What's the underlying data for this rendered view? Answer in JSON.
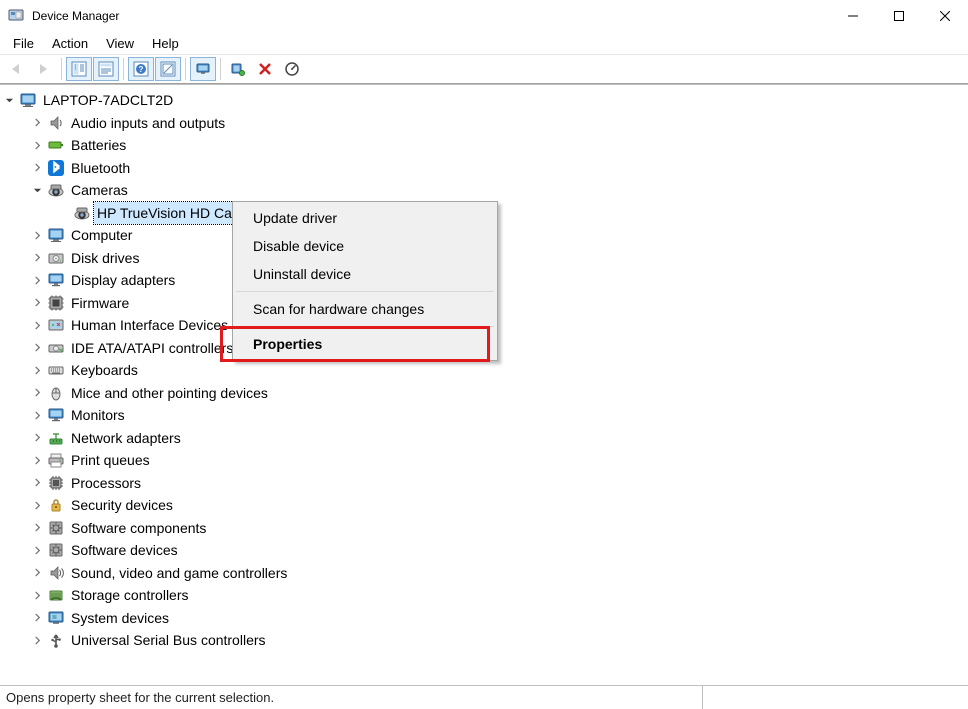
{
  "window": {
    "title": "Device Manager"
  },
  "menubar": [
    "File",
    "Action",
    "View",
    "Help"
  ],
  "tree": {
    "root": "LAPTOP-7ADCLT2D",
    "categories": [
      {
        "icon": "audio",
        "label": "Audio inputs and outputs"
      },
      {
        "icon": "battery",
        "label": "Batteries"
      },
      {
        "icon": "bluetooth",
        "label": "Bluetooth"
      },
      {
        "icon": "camera",
        "label": "Cameras",
        "expanded": true,
        "children": [
          {
            "icon": "camera",
            "label": "HP TrueVision HD Camera",
            "selected": true
          }
        ]
      },
      {
        "icon": "computer",
        "label": "Computer"
      },
      {
        "icon": "disk",
        "label": "Disk drives"
      },
      {
        "icon": "display",
        "label": "Display adapters"
      },
      {
        "icon": "firmware",
        "label": "Firmware"
      },
      {
        "icon": "hid",
        "label": "Human Interface Devices"
      },
      {
        "icon": "ide",
        "label": "IDE ATA/ATAPI controllers"
      },
      {
        "icon": "keyboard",
        "label": "Keyboards"
      },
      {
        "icon": "mouse",
        "label": "Mice and other pointing devices"
      },
      {
        "icon": "monitor",
        "label": "Monitors"
      },
      {
        "icon": "network",
        "label": "Network adapters"
      },
      {
        "icon": "printer",
        "label": "Print queues"
      },
      {
        "icon": "processor",
        "label": "Processors"
      },
      {
        "icon": "security",
        "label": "Security devices"
      },
      {
        "icon": "software",
        "label": "Software components"
      },
      {
        "icon": "software",
        "label": "Software devices"
      },
      {
        "icon": "sound",
        "label": "Sound, video and game controllers"
      },
      {
        "icon": "storage",
        "label": "Storage controllers"
      },
      {
        "icon": "system",
        "label": "System devices"
      },
      {
        "icon": "usb",
        "label": "Universal Serial Bus controllers"
      }
    ]
  },
  "context_menu": {
    "items": [
      {
        "label": "Update driver"
      },
      {
        "label": "Disable device"
      },
      {
        "label": "Uninstall device"
      },
      {
        "sep": true
      },
      {
        "label": "Scan for hardware changes"
      },
      {
        "sep": true
      },
      {
        "label": "Properties",
        "bold": true,
        "highlighted": true
      }
    ]
  },
  "statusbar": {
    "text": "Opens property sheet for the current selection."
  }
}
